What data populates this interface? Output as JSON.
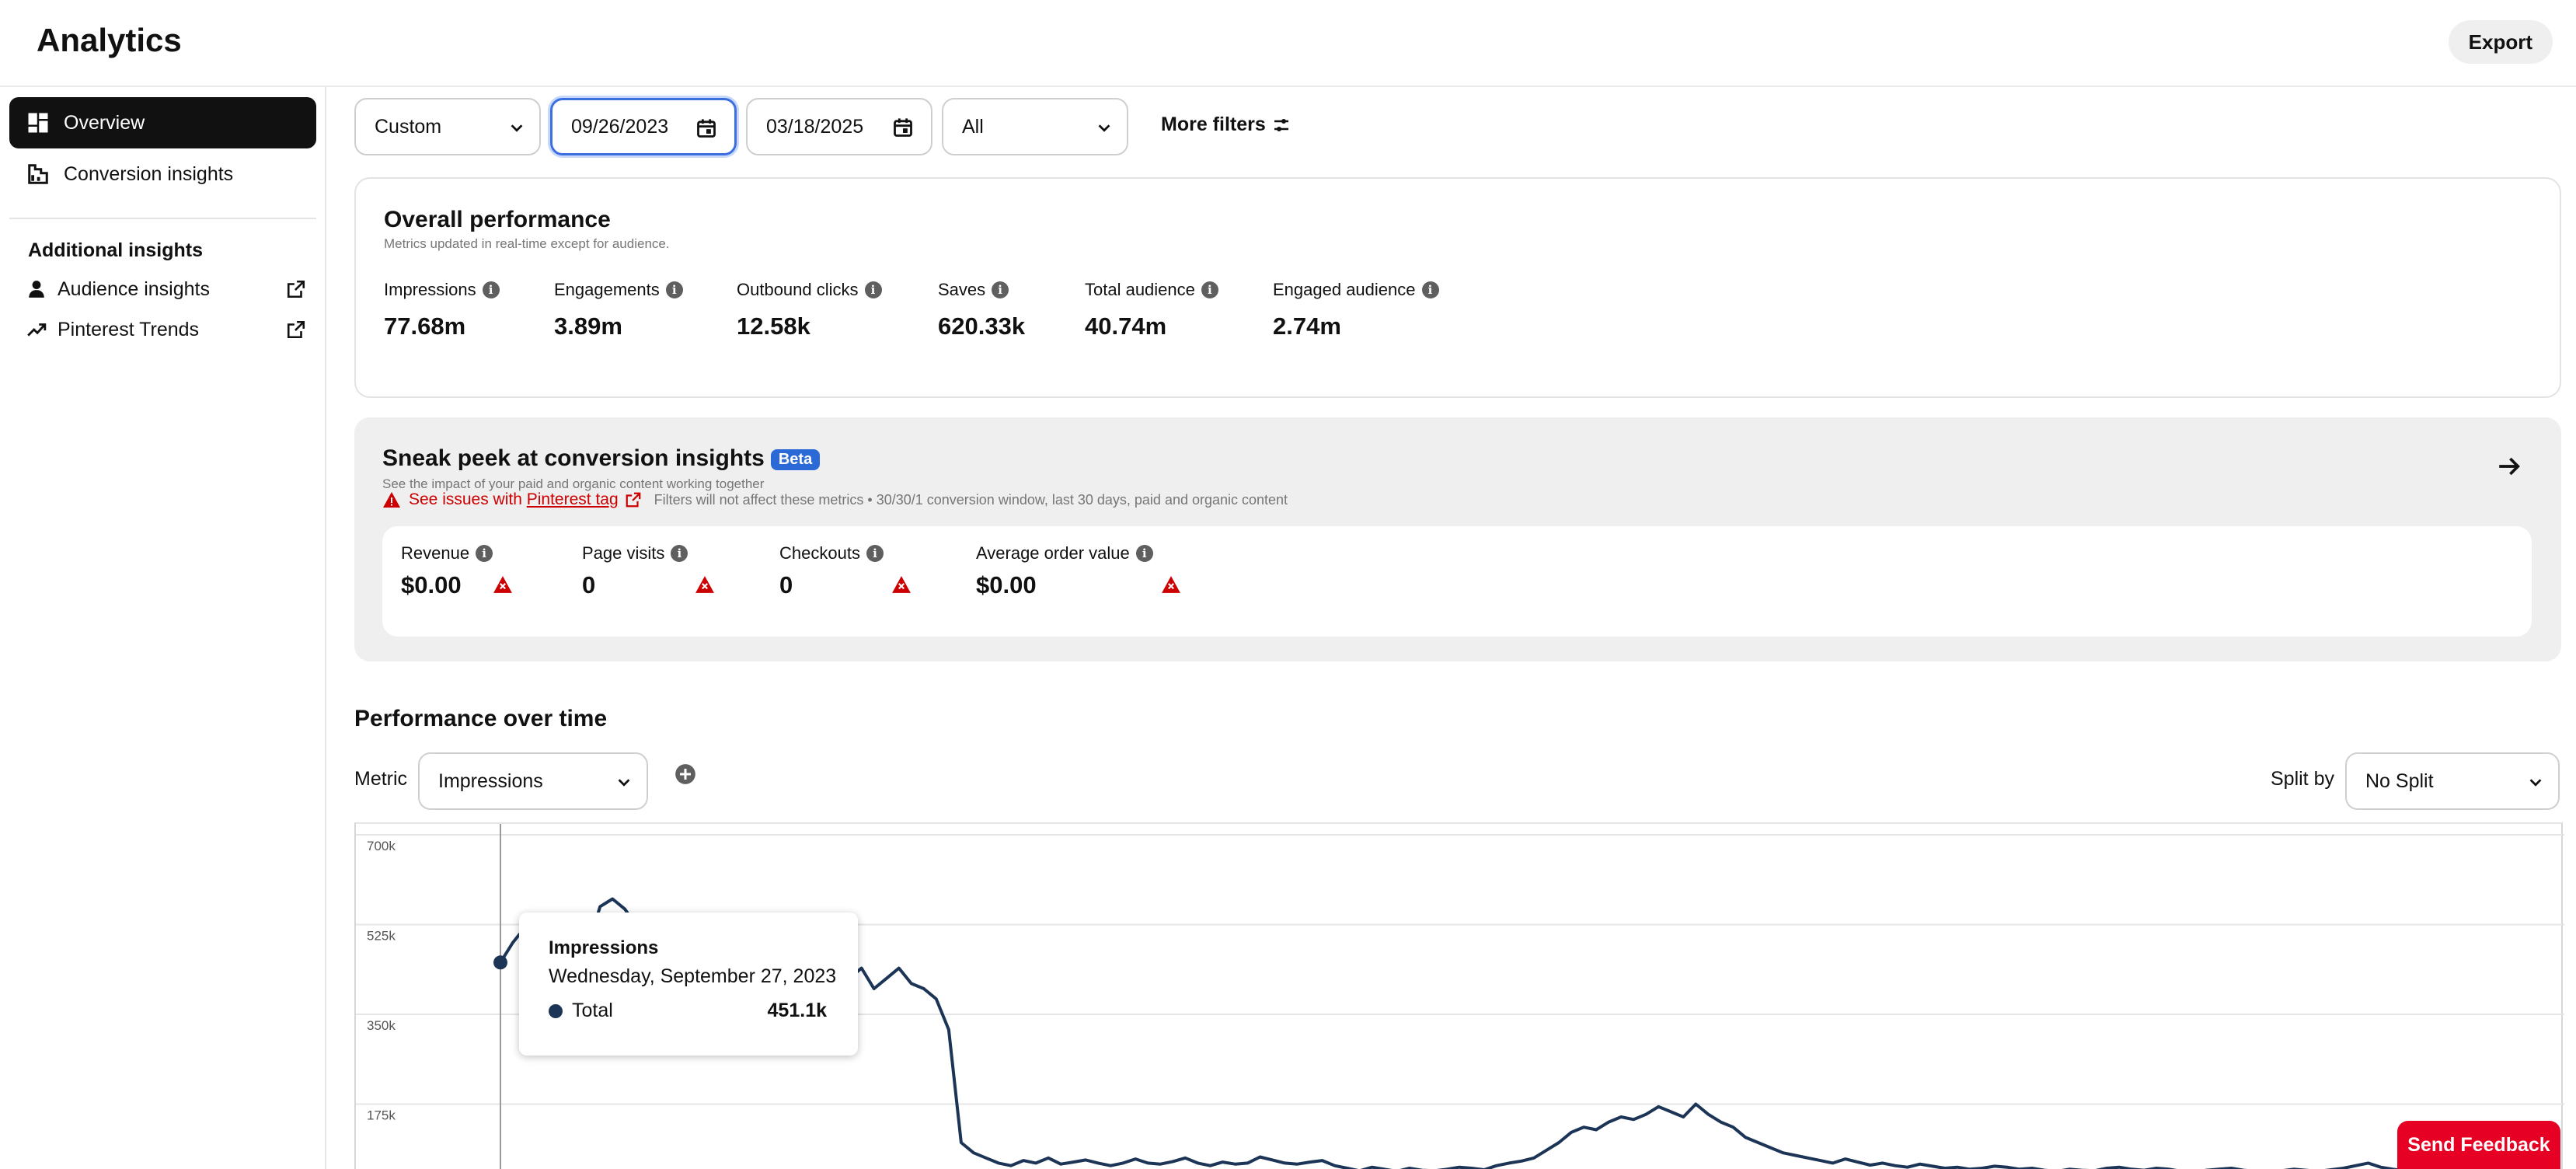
{
  "header": {
    "title": "Analytics",
    "export_label": "Export"
  },
  "sidebar": {
    "items": [
      {
        "label": "Overview",
        "icon": "dashboard-icon",
        "active": true
      },
      {
        "label": "Conversion insights",
        "icon": "conversion-icon",
        "active": false
      }
    ],
    "additional_heading": "Additional insights",
    "links": [
      {
        "label": "Audience insights",
        "icon": "person-icon"
      },
      {
        "label": "Pinterest Trends",
        "icon": "trend-icon"
      }
    ]
  },
  "filters": {
    "range": "Custom",
    "start_date": "09/26/2023",
    "end_date": "03/18/2025",
    "scope": "All",
    "more_filters": "More filters"
  },
  "overall": {
    "title": "Overall performance",
    "subtitle": "Metrics updated in real-time except for audience.",
    "metrics": [
      {
        "label": "Impressions",
        "value": "77.68m"
      },
      {
        "label": "Engagements",
        "value": "3.89m"
      },
      {
        "label": "Outbound clicks",
        "value": "12.58k"
      },
      {
        "label": "Saves",
        "value": "620.33k"
      },
      {
        "label": "Total audience",
        "value": "40.74m"
      },
      {
        "label": "Engaged audience",
        "value": "2.74m"
      }
    ]
  },
  "sneak": {
    "title": "Sneak peek at conversion insights",
    "badge": "Beta",
    "subtitle": "See the impact of your paid and organic content working together",
    "issue_prefix": "See issues with ",
    "issue_link": "Pinterest tag",
    "note": "Filters will not affect these metrics • 30/30/1 conversion window, last 30 days, paid and organic content",
    "metrics": [
      {
        "label": "Revenue",
        "value": "$0.00"
      },
      {
        "label": "Page visits",
        "value": "0"
      },
      {
        "label": "Checkouts",
        "value": "0"
      },
      {
        "label": "Average order value",
        "value": "$0.00"
      }
    ]
  },
  "perf": {
    "title": "Performance over time",
    "metric_label": "Metric",
    "metric_value": "Impressions",
    "split_label": "Split by",
    "split_value": "No Split"
  },
  "chart_data": {
    "type": "line",
    "y_ticks": [
      "700k",
      "525k",
      "350k",
      "175k"
    ],
    "ylim": [
      0,
      700000
    ],
    "series": [
      {
        "name": "Total",
        "values": [
          451100,
          490000,
          520000,
          470000,
          540000,
          500000,
          530000,
          480000,
          560000,
          575000,
          555000,
          520000,
          470000,
          450000,
          430000,
          440000,
          460000,
          420000,
          450000,
          440000,
          430000,
          420000,
          410000,
          430000,
          440000,
          420000,
          410000,
          430000,
          420000,
          440000,
          400000,
          420000,
          440000,
          410000,
          400000,
          380000,
          320000,
          100000,
          80000,
          70000,
          60000,
          55000,
          65000,
          60000,
          70000,
          58000,
          62000,
          66000,
          60000,
          55000,
          60000,
          68000,
          60000,
          58000,
          63000,
          70000,
          60000,
          55000,
          62000,
          58000,
          60000,
          72000,
          66000,
          60000,
          58000,
          62000,
          65000,
          55000,
          50000,
          45000,
          52000,
          48000,
          44000,
          50000,
          46000,
          45000,
          48000,
          52000,
          50000,
          47000,
          55000,
          60000,
          64000,
          70000,
          85000,
          100000,
          120000,
          130000,
          125000,
          140000,
          150000,
          145000,
          155000,
          170000,
          160000,
          150000,
          175000,
          155000,
          140000,
          130000,
          110000,
          100000,
          90000,
          80000,
          75000,
          70000,
          65000,
          60000,
          68000,
          62000,
          56000,
          60000,
          55000,
          52000,
          58000,
          54000,
          50000,
          52000,
          48000,
          50000,
          54000,
          52000,
          48000,
          50000,
          46000,
          44000,
          48000,
          46000,
          45000,
          50000,
          52000,
          48000,
          46000,
          50000,
          48000,
          44000,
          42000,
          46000,
          48000,
          50000,
          46000,
          44000,
          42000,
          45000,
          48000,
          46000,
          44000,
          47000,
          50000,
          55000,
          60000,
          52000,
          48000,
          45000,
          42000,
          40000,
          44000,
          42000,
          40000,
          43000,
          45000,
          48000,
          44000,
          42000,
          40000,
          38000
        ]
      }
    ],
    "tooltip": {
      "metric": "Impressions",
      "date": "Wednesday, September 27, 2023",
      "series": "Total",
      "value": "451.1k"
    }
  },
  "feedback_label": "Send Feedback"
}
